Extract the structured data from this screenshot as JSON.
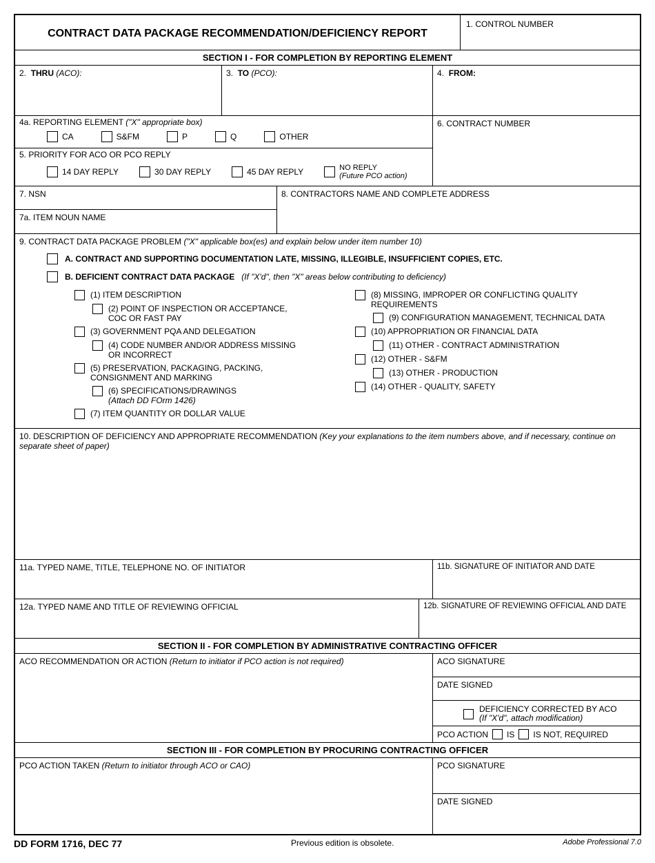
{
  "title": "CONTRACT DATA PACKAGE RECOMMENDATION/DEFICIENCY REPORT",
  "box1": "1.  CONTROL NUMBER",
  "sectionI": "SECTION I - FOR COMPLETION BY REPORTING ELEMENT",
  "box2_num": "2.",
  "box2_lbl": "THRU",
  "box2_suf": "(ACO):",
  "box3_num": "3.",
  "box3_lbl": "TO",
  "box3_suf": "(PCO):",
  "box4_num": "4.",
  "box4_lbl": "FROM:",
  "box4a": "4a.  REPORTING ELEMENT",
  "box4a_hint": "(\"X\" appropriate box)",
  "re": {
    "ca": "CA",
    "sfm": "S&FM",
    "p": "P",
    "q": "Q",
    "other": "OTHER"
  },
  "box5": "5.  PRIORITY FOR ACO OR PCO REPLY",
  "prio": {
    "d14": "14 DAY REPLY",
    "d30": "30 DAY REPLY",
    "d45": "45 DAY REPLY",
    "noreply": "NO REPLY",
    "noreply_sub": "(Future PCO action)"
  },
  "box6": "6.  CONTRACT NUMBER",
  "box7": "7.  NSN",
  "box7a": "7a.  ITEM NOUN NAME",
  "box8": "8.  CONTRACTORS NAME AND COMPLETE ADDRESS",
  "box9": "9.  CONTRACT DATA PACKAGE PROBLEM",
  "box9_hint": "(\"X\" applicable box(es) and explain below under item number 10)",
  "p9a": "A.  CONTRACT AND SUPPORTING DOCUMENTATION LATE, MISSING, ILLEGIBLE, INSUFFICIENT COPIES, ETC.",
  "p9b": "B.  DEFICIENT CONTRACT DATA PACKAGE",
  "p9b_hint": "(If \"X'd\", then \"X\" areas below contributing to deficiency)",
  "d": {
    "i1": "(1) ITEM DESCRIPTION",
    "i2": "(2) POINT OF INSPECTION OR ACCEPTANCE,",
    "i2b": "COC OR FAST PAY",
    "i3": "(3) GOVERNMENT PQA AND DELEGATION",
    "i4": "(4) CODE NUMBER AND/OR ADDRESS MISSING",
    "i4b": "OR INCORRECT",
    "i5": "(5) PRESERVATION, PACKAGING, PACKING,",
    "i5b": "CONSIGNMENT AND MARKING",
    "i6": "(6) SPECIFICATIONS/DRAWINGS",
    "i6b": "(Attach DD FOrm 1426)",
    "i7": "(7) ITEM QUANTITY OR DOLLAR VALUE",
    "i8": "(8) MISSING, IMPROPER OR CONFLICTING QUALITY REQUIREMENTS",
    "i9": "(9) CONFIGURATION MANAGEMENT, TECHNICAL DATA",
    "i10": "(10) APPROPRIATION OR FINANCIAL DATA",
    "i11": "(11) OTHER - CONTRACT ADMINISTRATION",
    "i12": "(12) OTHER - S&FM",
    "i13": "(13) OTHER - PRODUCTION",
    "i14": "(14) OTHER - QUALITY, SAFETY"
  },
  "box10": "10.  DESCRIPTION OF DEFICIENCY AND APPROPRIATE RECOMMENDATION",
  "box10_hint": "(Key your explanations to the item numbers above, and if necessary, continue on separate sheet of paper)",
  "box11a": "11a.  TYPED NAME, TITLE, TELEPHONE NO. OF INITIATOR",
  "box11b": "11b.  SIGNATURE OF INITIATOR AND DATE",
  "box12a": "12a.  TYPED NAME AND TITLE OF REVIEWING OFFICIAL",
  "box12b": "12b.  SIGNATURE OF REVIEWING OFFICIAL AND DATE",
  "sectionII": "SECTION II - FOR COMPLETION BY ADMINISTRATIVE CONTRACTING OFFICER",
  "aco_rec": "ACO RECOMMENDATION OR ACTION",
  "aco_rec_hint": "(Return to initiator if PCO action is not required)",
  "aco_sig": "ACO SIGNATURE",
  "date_signed": "DATE SIGNED",
  "aco_def": "DEFICIENCY CORRECTED BY ACO",
  "aco_def_hint": "(If \"X'd\", attach modification)",
  "pco_action": "PCO ACTION",
  "is": "IS",
  "isnot": "IS NOT, REQUIRED",
  "sectionIII": "SECTION III - FOR COMPLETION BY PROCURING CONTRACTING OFFICER",
  "pco_taken": "PCO ACTION TAKEN",
  "pco_taken_hint": "(Return to initiator through ACO or CAO)",
  "pco_sig": "PCO SIGNATURE",
  "footer_l": "DD FORM 1716, DEC 77",
  "footer_c": "Previous edition is obsolete.",
  "footer_r": "Adobe Professional 7.0"
}
